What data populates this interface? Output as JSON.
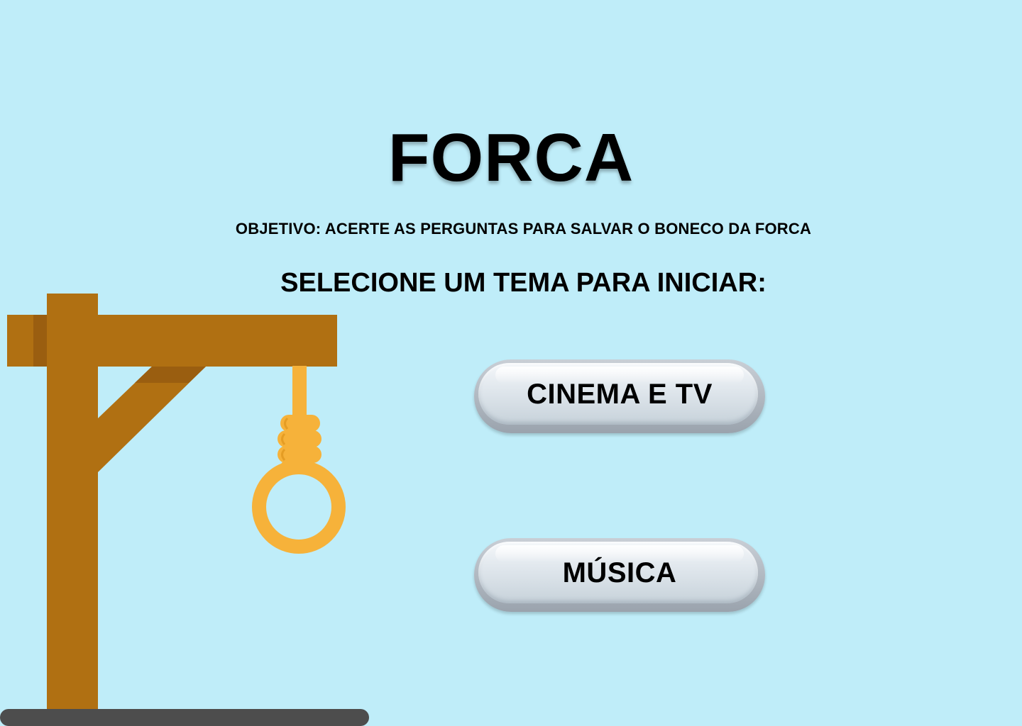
{
  "game": {
    "title": "FORCA",
    "objective": "OBJETIVO: ACERTE AS PERGUNTAS PARA SALVAR O BONECO DA FORCA",
    "select_prompt": "SELECIONE UM TEMA PARA INICIAR:"
  },
  "themes": [
    {
      "label": "CINEMA E TV"
    },
    {
      "label": "MÚSICA"
    }
  ],
  "illustration": {
    "icon": "gallows-with-noose-icon"
  },
  "colors": {
    "background": "#bfedf9",
    "wood": "#b07012",
    "wood_shadow": "#9a5e10",
    "rope": "#f6b23a",
    "ground": "#4d4d4d"
  }
}
